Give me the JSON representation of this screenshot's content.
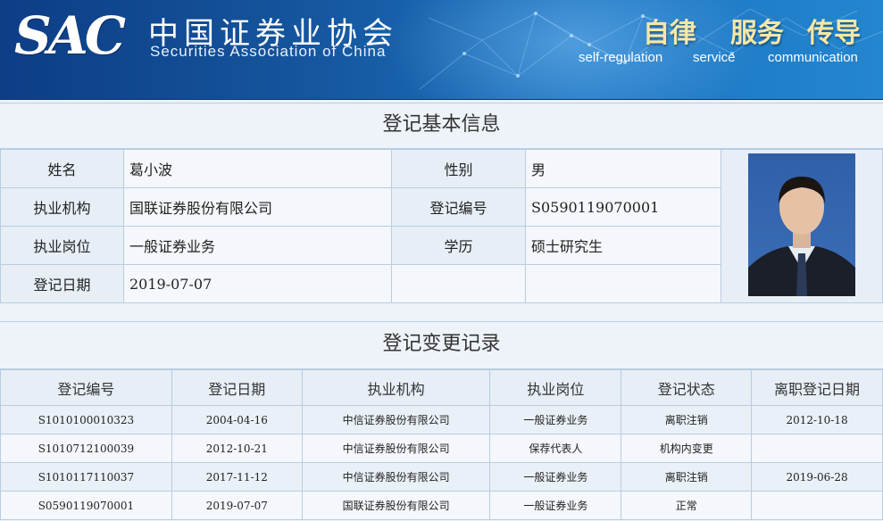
{
  "header": {
    "logo": "SAC",
    "name_cn": "中国证券业协会",
    "name_en": "Securities Association of China",
    "slogans": [
      {
        "cn": "自律",
        "en": "self-regulation"
      },
      {
        "cn": "服务",
        "en": "service"
      },
      {
        "cn": "传导",
        "en": "communication"
      }
    ]
  },
  "basic_info": {
    "title": "登记基本信息",
    "rows": [
      {
        "l1": "姓名",
        "v1": "葛小波",
        "l2": "性别",
        "v2": "男"
      },
      {
        "l1": "执业机构",
        "v1": "国联证券股份有限公司",
        "l2": "登记编号",
        "v2": "S0590119070001"
      },
      {
        "l1": "执业岗位",
        "v1": "一般证券业务",
        "l2": "学历",
        "v2": "硕士研究生"
      },
      {
        "l1": "登记日期",
        "v1": "2019-07-07",
        "l2": "",
        "v2": ""
      }
    ]
  },
  "change_records": {
    "title": "登记变更记录",
    "columns": [
      "登记编号",
      "登记日期",
      "执业机构",
      "执业岗位",
      "登记状态",
      "离职登记日期"
    ],
    "rows": [
      [
        "S1010100010323",
        "2004-04-16",
        "中信证券股份有限公司",
        "一般证券业务",
        "离职注销",
        "2012-10-18"
      ],
      [
        "S1010712100039",
        "2012-10-21",
        "中信证券股份有限公司",
        "保荐代表人",
        "机构内变更",
        ""
      ],
      [
        "S1010117110037",
        "2017-11-12",
        "中信证券股份有限公司",
        "一般证券业务",
        "离职注销",
        "2019-06-28"
      ],
      [
        "S0590119070001",
        "2019-07-07",
        "国联证券股份有限公司",
        "一般证券业务",
        "正常",
        ""
      ]
    ]
  }
}
